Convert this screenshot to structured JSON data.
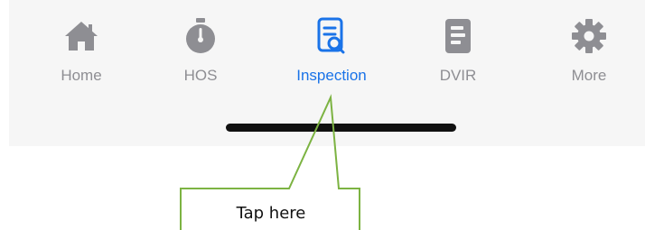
{
  "tabbar": {
    "tabs": [
      {
        "label": "Home",
        "icon": "home-icon",
        "active": false
      },
      {
        "label": "HOS",
        "icon": "stopwatch-icon",
        "active": false
      },
      {
        "label": "Inspection",
        "icon": "inspection-document-search-icon",
        "active": true
      },
      {
        "label": "DVIR",
        "icon": "report-document-icon",
        "active": false
      },
      {
        "label": "More",
        "icon": "gear-icon",
        "active": false
      }
    ]
  },
  "callout": {
    "text": "Tap here",
    "line_color": "#7cb342"
  },
  "colors": {
    "inactive": "#8e8e93",
    "active": "#1a73e8",
    "tabbar_background": "#f6f6f6"
  }
}
